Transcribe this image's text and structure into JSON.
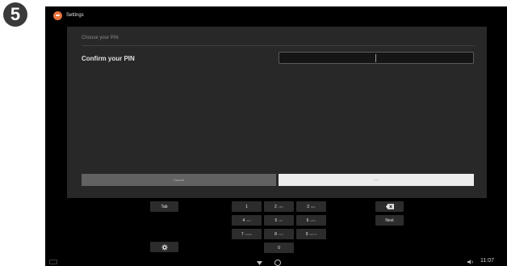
{
  "step": {
    "number": "5"
  },
  "titlebar": {
    "app_title": "Settings"
  },
  "dialog": {
    "title": "Choose your PIN",
    "label": "Confirm your PIN",
    "pin_value": "",
    "cancel_label": "Cancel",
    "ok_label": "OK"
  },
  "keyboard": {
    "tab": "Tab",
    "next": "Next",
    "keys": [
      {
        "num": "1",
        "letters": ""
      },
      {
        "num": "2",
        "letters": "ABC"
      },
      {
        "num": "3",
        "letters": "DEF"
      },
      {
        "num": "4",
        "letters": "GHI"
      },
      {
        "num": "5",
        "letters": "JKL"
      },
      {
        "num": "6",
        "letters": "MNO"
      },
      {
        "num": "7",
        "letters": "PQRS"
      },
      {
        "num": "8",
        "letters": "TUV"
      },
      {
        "num": "9",
        "letters": "WXYZ"
      },
      {
        "num": "0",
        "letters": ""
      }
    ],
    "icons": {
      "backspace": "backspace-icon",
      "settings": "gear-icon"
    }
  },
  "statusbar": {
    "time": "11:07"
  },
  "colors": {
    "accent": "#e8743b",
    "dialog_bg": "#282828",
    "ok_bg": "#ececec",
    "cancel_bg": "#626262"
  }
}
